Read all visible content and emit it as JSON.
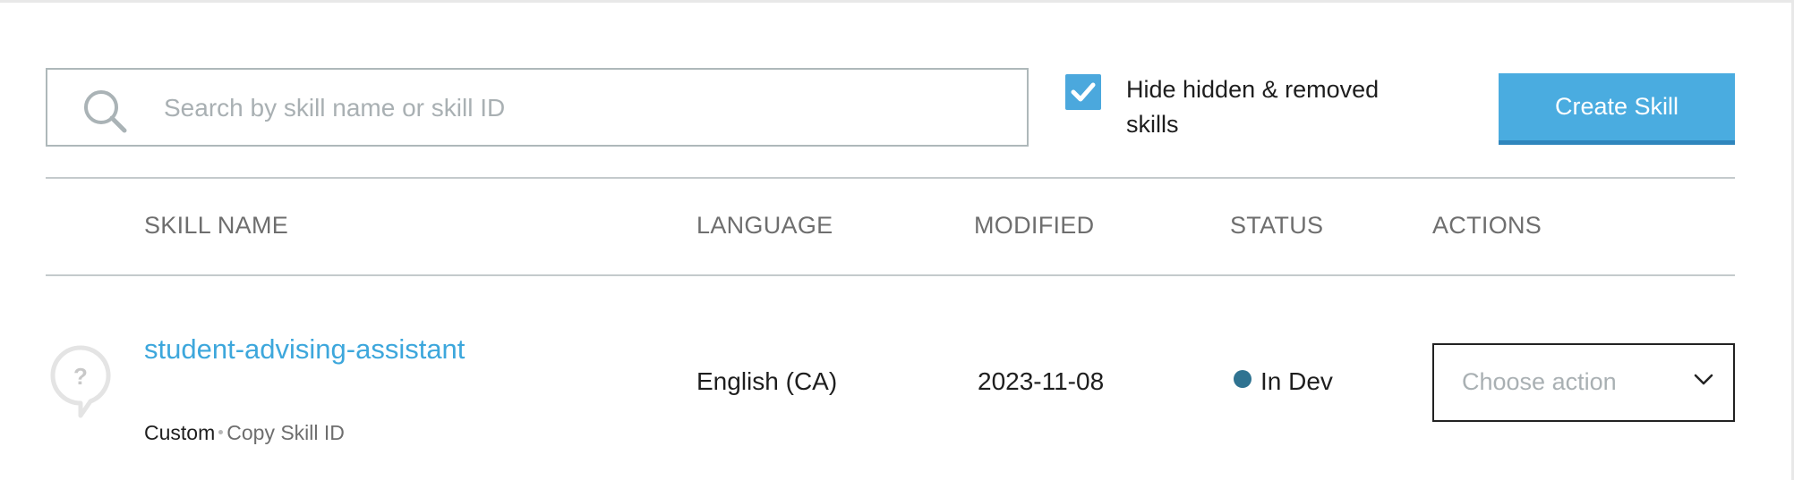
{
  "toolbar": {
    "search_placeholder": "Search by skill name or skill ID",
    "search_value": "",
    "hide_toggle_label": "Hide hidden & removed skills",
    "hide_toggle_checked": true,
    "create_button_label": "Create Skill"
  },
  "table": {
    "columns": [
      "SKILL NAME",
      "LANGUAGE",
      "MODIFIED",
      "STATUS",
      "ACTIONS"
    ],
    "rows": [
      {
        "icon": "question-bubble-icon",
        "name": "student-advising-assistant",
        "type": "Custom",
        "copy_link": "Copy Skill ID",
        "language": "English (CA)",
        "modified": "2023-11-08",
        "status": "In Dev",
        "action_placeholder": "Choose action"
      }
    ]
  },
  "colors": {
    "accent": "#4aace0",
    "link": "#3da7dc",
    "status_in_dev": "#2f7391",
    "header_text": "#6e6e6e"
  }
}
